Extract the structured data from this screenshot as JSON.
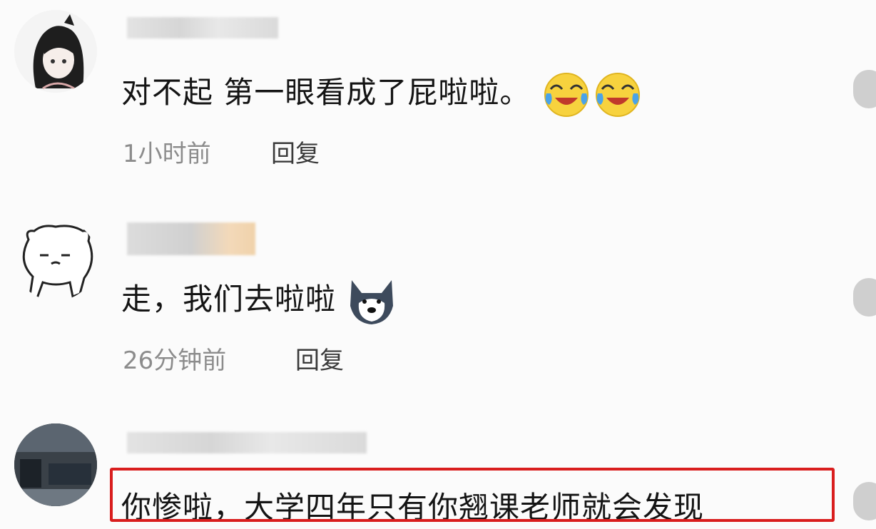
{
  "comments": [
    {
      "text": "对不起 第一眼看成了屁啦啦。",
      "time": "1小时前",
      "reply": "回复",
      "emojis": [
        "crying-laughing-emoji",
        "crying-laughing-emoji"
      ]
    },
    {
      "text": "走，我们去啦啦",
      "time": "26分钟前",
      "reply": "回复",
      "emojis": [
        "husky-dog-emoji"
      ]
    },
    {
      "text": "你惨啦，大学四年只有你翘课老师就会发现",
      "highlighted": true
    }
  ],
  "colors": {
    "highlight_border": "#d91e1e",
    "text": "#141414",
    "meta": "#8c8c8c"
  }
}
